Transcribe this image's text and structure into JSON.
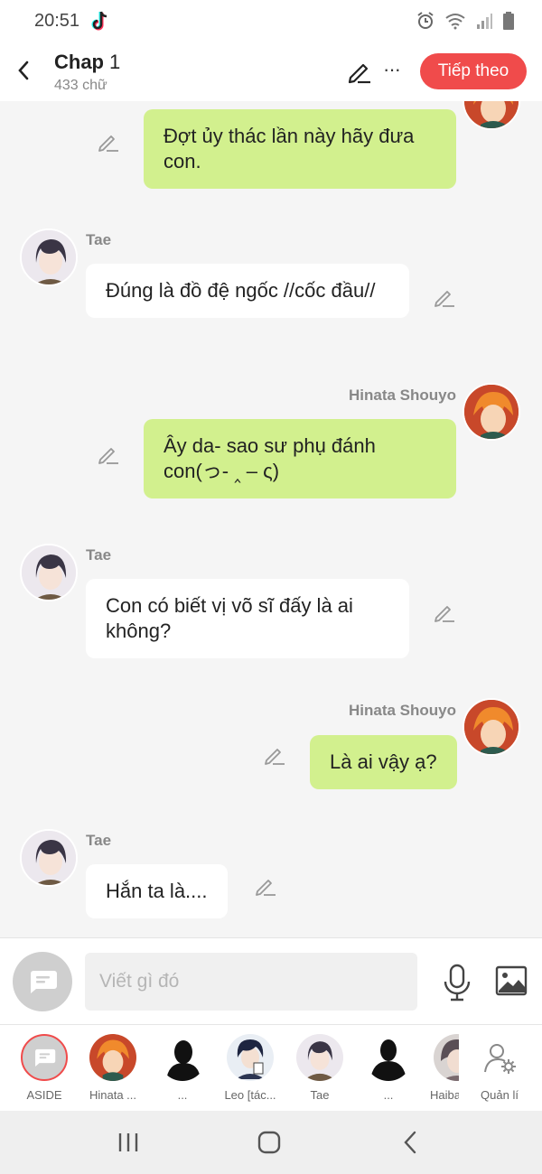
{
  "status": {
    "time": "20:51"
  },
  "header": {
    "title": "Chap",
    "chapter_number": "1",
    "word_count": "433 chữ",
    "next_label": "Tiếp theo"
  },
  "messages": [
    {
      "side": "right",
      "sender": "",
      "text": "Đợt ủy thác lần này hãy đưa con."
    },
    {
      "side": "left",
      "sender": "Tae",
      "text": "Đúng là đồ đệ ngốc //cốc đầu//"
    },
    {
      "side": "right",
      "sender": "Hinata Shouyo",
      "text": "Ây da- sao sư phụ đánh con(っ- ‸ – ς)"
    },
    {
      "side": "left",
      "sender": "Tae",
      "text": "Con có biết vị võ sĩ đấy là ai không?"
    },
    {
      "side": "right",
      "sender": "Hinata Shouyo",
      "text": "Là ai vậy ạ?"
    },
    {
      "side": "left",
      "sender": "Tae",
      "text": "Hắn ta là...."
    }
  ],
  "composer": {
    "placeholder": "Viết gì đó"
  },
  "characters": [
    {
      "label": "ASIDE"
    },
    {
      "label": "Hinata ..."
    },
    {
      "label": "..."
    },
    {
      "label": "Leo [tác..."
    },
    {
      "label": "Tae"
    },
    {
      "label": "..."
    },
    {
      "label": "Haiba"
    },
    {
      "label": "Quản lí"
    }
  ],
  "colors": {
    "accent": "#f04b4b",
    "bubble_self": "#d2f08e",
    "bubble_other": "#ffffff"
  }
}
